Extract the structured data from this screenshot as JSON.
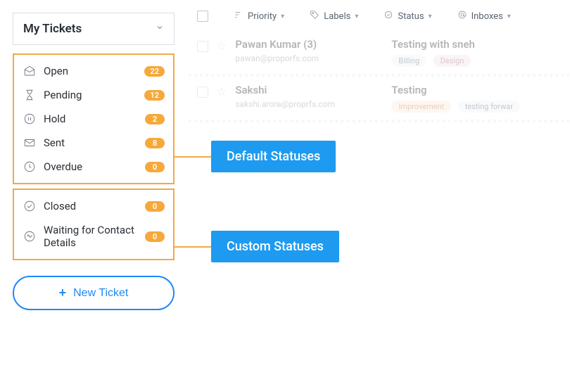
{
  "sidebar": {
    "title": "My Tickets",
    "default_statuses": [
      {
        "icon": "envelope-open-icon",
        "label": "Open",
        "count": "22"
      },
      {
        "icon": "hourglass-icon",
        "label": "Pending",
        "count": "12"
      },
      {
        "icon": "pause-circle-icon",
        "label": "Hold",
        "count": "2"
      },
      {
        "icon": "envelope-icon",
        "label": "Sent",
        "count": "8"
      },
      {
        "icon": "clock-icon",
        "label": "Overdue",
        "count": "0"
      }
    ],
    "custom_statuses": [
      {
        "icon": "check-circle-icon",
        "label": "Closed",
        "count": "0"
      },
      {
        "icon": "activity-circle-icon",
        "label": "Waiting for Contact Details",
        "count": "0"
      }
    ],
    "new_ticket_label": "New Ticket"
  },
  "toolbar": {
    "priority": "Priority",
    "labels": "Labels",
    "status": "Status",
    "inboxes": "Inboxes"
  },
  "tickets": [
    {
      "sender": "Pawan Kumar (3)",
      "email": "pawan@proporfs.com",
      "subject": "Testing with sneh",
      "tags": [
        {
          "text": "Billing",
          "cls": ""
        },
        {
          "text": "Design",
          "cls": "design"
        }
      ]
    },
    {
      "sender": "Sakshi",
      "email": "sakshi.arora@proprfs.com",
      "subject": "Testing",
      "tags": [
        {
          "text": "Improvement",
          "cls": "improve"
        },
        {
          "text": "testing forwar",
          "cls": ""
        }
      ]
    }
  ],
  "callouts": {
    "default": "Default Statuses",
    "custom": "Custom Statuses"
  }
}
